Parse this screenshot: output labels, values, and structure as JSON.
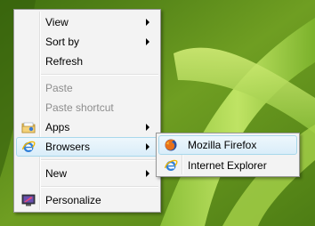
{
  "context_menu": {
    "items": [
      {
        "label": "View",
        "has_submenu": true,
        "enabled": true
      },
      {
        "label": "Sort by",
        "has_submenu": true,
        "enabled": true
      },
      {
        "label": "Refresh",
        "has_submenu": false,
        "enabled": true
      },
      {
        "label": "Paste",
        "has_submenu": false,
        "enabled": false
      },
      {
        "label": "Paste shortcut",
        "has_submenu": false,
        "enabled": false
      },
      {
        "label": "Apps",
        "has_submenu": true,
        "enabled": true,
        "icon": "folder-apps-icon"
      },
      {
        "label": "Browsers",
        "has_submenu": true,
        "enabled": true,
        "highlighted": true,
        "icon": "internet-explorer-icon"
      },
      {
        "label": "New",
        "has_submenu": true,
        "enabled": true
      },
      {
        "label": "Personalize",
        "has_submenu": false,
        "enabled": true,
        "icon": "personalize-monitor-icon"
      }
    ]
  },
  "browsers_submenu": {
    "items": [
      {
        "label": "Mozilla Firefox",
        "icon": "firefox-icon",
        "highlighted": true
      },
      {
        "label": "Internet Explorer",
        "icon": "internet-explorer-icon"
      }
    ]
  },
  "colors": {
    "menu_background": "#f3f3f3",
    "menu_border": "#979797",
    "highlight_border": "#a8d8eb",
    "disabled_text": "#8d8d8d",
    "desktop_green": "#5d8a1c"
  }
}
